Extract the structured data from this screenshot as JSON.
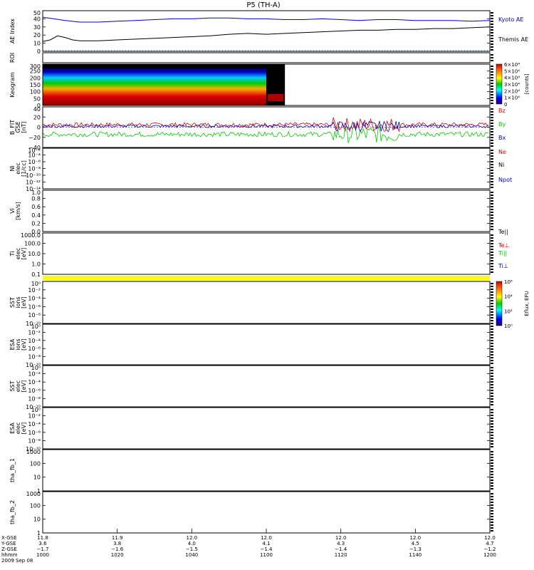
{
  "title": "P5 (TH-A)",
  "colors": {
    "blue": "#0000cc",
    "red": "#dd0000",
    "green": "#00cc00",
    "black": "#000000",
    "yellow": "#ffff00",
    "cyan": "#00aaaa"
  },
  "panels": [
    {
      "id": "ae",
      "ylabel": "AE Index",
      "ticks": [
        "0",
        "10",
        "20",
        "30",
        "40",
        "50"
      ],
      "ylim": [
        0,
        50
      ],
      "scale": "linear"
    },
    {
      "id": "roi",
      "ylabel": "ROI",
      "ticks": [],
      "scale": "none"
    },
    {
      "id": "keogram",
      "ylabel": "Keogram",
      "ticks": [
        "0",
        "50",
        "100",
        "150",
        "200",
        "250",
        "300"
      ],
      "ylim": [
        0,
        300
      ],
      "scale": "linear"
    },
    {
      "id": "bfit",
      "ylabel": "B_FIT",
      "ylabel2": "GSE",
      "ylabel3": "[nT]",
      "ticks": [
        "−40",
        "−20",
        "0",
        "20",
        "40"
      ],
      "ylim": [
        -40,
        40
      ],
      "scale": "linear"
    },
    {
      "id": "ni",
      "ylabel": "Ni",
      "ylabel2": "elec",
      "ylabel3": "[1/cc]",
      "ticks": [
        "10⁻¹⁴",
        "10⁻¹²",
        "10⁻¹⁰",
        "10⁻⁸",
        "10⁻⁶",
        "10⁻⁴",
        "10⁻²"
      ],
      "scale": "log"
    },
    {
      "id": "vi",
      "ylabel": "Vi",
      "ylabel2": "[km/s]",
      "ticks": [
        "0.0",
        "0.2",
        "0.4",
        "0.6",
        "0.8",
        "1.0"
      ],
      "ylim": [
        0,
        1
      ],
      "scale": "linear"
    },
    {
      "id": "ti",
      "ylabel": "Ti",
      "ylabel2": "elec",
      "ylabel3": "[eV]",
      "ticks": [
        "0.1",
        "1.0",
        "10.0",
        "100.0",
        "1000.0"
      ],
      "scale": "log"
    },
    {
      "id": "sst_ion",
      "ylabel": "SST",
      "ylabel2": "ions",
      "ylabel3": "[eV]",
      "ticks": [
        "10⁻¹⁰",
        "10⁻⁸",
        "10⁻⁶",
        "10⁻⁴",
        "10⁻²",
        "10⁰"
      ],
      "scale": "log"
    },
    {
      "id": "esa_ion",
      "ylabel": "ESA",
      "ylabel2": "ions",
      "ylabel3": "[eV]",
      "ticks": [
        "10⁻¹⁰",
        "10⁻⁸",
        "10⁻⁶",
        "10⁻⁴",
        "10⁻²",
        "10⁰"
      ],
      "scale": "log"
    },
    {
      "id": "sst_elec",
      "ylabel": "SST",
      "ylabel2": "elec",
      "ylabel3": "[eV]",
      "ticks": [
        "10⁻¹⁰",
        "10⁻⁸",
        "10⁻⁶",
        "10⁻⁴",
        "10⁻²",
        "10⁰"
      ],
      "scale": "log"
    },
    {
      "id": "esa_elec",
      "ylabel": "ESA",
      "ylabel2": "elec",
      "ylabel3": "[eV]",
      "ticks": [
        "10⁻¹⁰",
        "10⁻⁸",
        "10⁻⁶",
        "10⁻⁴",
        "10⁻²",
        "10⁰"
      ],
      "scale": "log"
    },
    {
      "id": "fb1",
      "ylabel": "tha_fb_1",
      "ticks": [
        "1",
        "10",
        "100",
        "1000"
      ],
      "scale": "log"
    },
    {
      "id": "fb2",
      "ylabel": "tha_fb_2",
      "ticks": [
        "1",
        "10",
        "100",
        "1000"
      ],
      "scale": "log"
    }
  ],
  "right_labels": {
    "ae": [
      {
        "text": "Kyoto AE",
        "color": "#0000cc"
      },
      {
        "text": "Themis AE",
        "color": "#000000"
      }
    ],
    "bfit": [
      {
        "text": "Bz",
        "color": "#dd0000"
      },
      {
        "text": "By",
        "color": "#00cc00"
      },
      {
        "text": "Bx",
        "color": "#0000cc"
      }
    ],
    "ni": [
      {
        "text": "Ne",
        "color": "#dd0000"
      },
      {
        "text": "Ni",
        "color": "#000000"
      },
      {
        "text": "Npot",
        "color": "#0000cc"
      }
    ],
    "ti": [
      {
        "text": "Te||",
        "color": "#000000"
      },
      {
        "text": "Te⊥",
        "color": "#dd0000"
      },
      {
        "text": "Ti||",
        "color": "#00cc00"
      },
      {
        "text": "Ti⊥",
        "color": "#0000cc"
      }
    ]
  },
  "colorbars": [
    {
      "panel": "keogram",
      "ticks": [
        "0",
        "1×10⁴",
        "2×10⁴",
        "3×10⁴",
        "4×10⁴",
        "5×10⁴",
        "6×10⁴"
      ],
      "label": "[counts]"
    },
    {
      "panel": "sst_ion",
      "ticks": [
        "10⁰",
        "10²",
        "10⁴",
        "10⁶"
      ],
      "label": "Eflux, EFU"
    }
  ],
  "xaxis": {
    "row_labels": [
      "X-GSE",
      "Y-GSE",
      "Z-GSE",
      "hhmm",
      "2009 Sep 08"
    ],
    "columns": [
      {
        "x": "11.8",
        "y": "3.6",
        "z": "−1.7",
        "t": "1000"
      },
      {
        "x": "11.9",
        "y": "3.8",
        "z": "−1.6",
        "t": "1020"
      },
      {
        "x": "12.0",
        "y": "4.0",
        "z": "−1.5",
        "t": "1040"
      },
      {
        "x": "12.0",
        "y": "4.1",
        "z": "−1.4",
        "t": "1100"
      },
      {
        "x": "12.0",
        "y": "4.3",
        "z": "−1.4",
        "t": "1120"
      },
      {
        "x": "12.0",
        "y": "4.5",
        "z": "−1.3",
        "t": "1140"
      },
      {
        "x": "12.0",
        "y": "4.7",
        "z": "−1.2",
        "t": "1200"
      }
    ]
  },
  "chart_data": {
    "type": "line",
    "title": "P5 (TH-A)",
    "x_unit": "minutes after 10:00 UT",
    "xlim": [
      0,
      120
    ],
    "ae_series": [
      {
        "name": "Kyoto AE",
        "x": [
          0,
          3,
          6,
          10,
          15,
          20,
          25,
          30,
          35,
          40,
          45,
          50,
          55,
          60,
          65,
          70,
          75,
          80,
          85,
          90,
          95,
          100,
          105,
          110,
          115,
          120
        ],
        "values": [
          42,
          40,
          38,
          36,
          36,
          37,
          38,
          39,
          40,
          40,
          41,
          41,
          40,
          40,
          39,
          39,
          40,
          39,
          38,
          39,
          39,
          38,
          38,
          38,
          37,
          38
        ]
      },
      {
        "name": "Themis AE",
        "x": [
          0,
          2,
          4,
          6,
          8,
          10,
          15,
          20,
          25,
          30,
          35,
          40,
          45,
          50,
          55,
          60,
          65,
          70,
          75,
          80,
          85,
          90,
          95,
          100,
          105,
          110,
          115,
          120
        ],
        "values": [
          12,
          14,
          19,
          17,
          14,
          13,
          13,
          14,
          15,
          16,
          17,
          18,
          19,
          21,
          22,
          21,
          22,
          23,
          24,
          25,
          26,
          26,
          27,
          27,
          28,
          28,
          29,
          30
        ]
      }
    ],
    "keogram": {
      "ylim": [
        0,
        300
      ],
      "data_x_end": 60,
      "x_end": 65
    },
    "bfit": {
      "ylim": [
        -40,
        40
      ],
      "series": [
        {
          "name": "Bz",
          "mean": 5,
          "amp": 4
        },
        {
          "name": "By",
          "mean": -14,
          "amp": 5
        },
        {
          "name": "Bx",
          "mean": 2,
          "amp": 3
        }
      ]
    }
  }
}
